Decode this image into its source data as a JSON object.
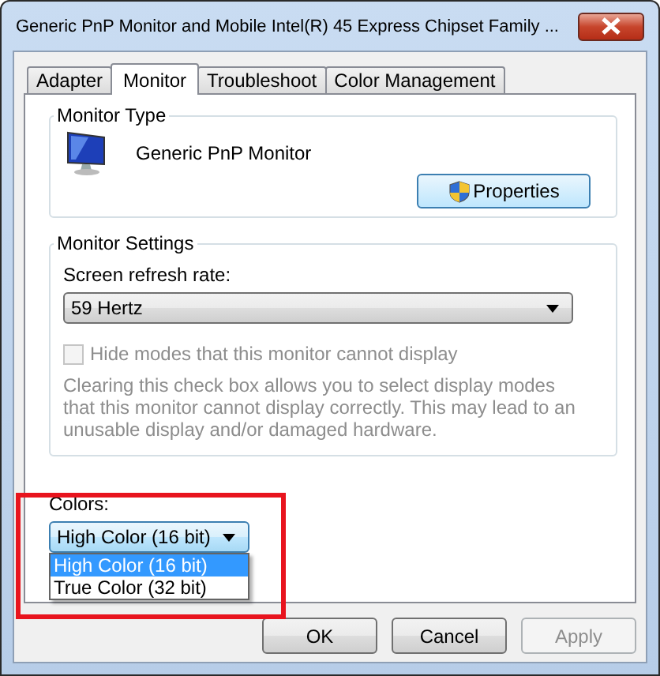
{
  "window": {
    "title": "Generic PnP Monitor and Mobile Intel(R) 45 Express Chipset Family ..."
  },
  "tabs": [
    {
      "label": "Adapter",
      "selected": false
    },
    {
      "label": "Monitor",
      "selected": true
    },
    {
      "label": "Troubleshoot",
      "selected": false
    },
    {
      "label": "Color Management",
      "selected": false
    }
  ],
  "monitor_type": {
    "heading": "Monitor Type",
    "device": "Generic PnP Monitor",
    "button": "Properties"
  },
  "monitor_settings": {
    "heading": "Monitor Settings",
    "refresh_label": "Screen refresh rate:",
    "refresh_value": "59 Hertz",
    "hide_modes": {
      "label": "Hide modes that this monitor cannot display",
      "checked": false,
      "disabled": true
    },
    "note": "Clearing this check box allows you to select display modes that this monitor cannot display correctly. This may lead to an unusable display and/or damaged hardware."
  },
  "colors": {
    "label": "Colors:",
    "value": "High Color (16 bit)",
    "expanded": true,
    "highlighted": true,
    "options": [
      {
        "label": "High Color (16 bit)",
        "selected": true
      },
      {
        "label": "True Color (32 bit)",
        "selected": false
      }
    ]
  },
  "buttons": [
    {
      "label": "OK",
      "disabled": false
    },
    {
      "label": "Cancel",
      "disabled": false
    },
    {
      "label": "Apply",
      "disabled": true
    }
  ]
}
